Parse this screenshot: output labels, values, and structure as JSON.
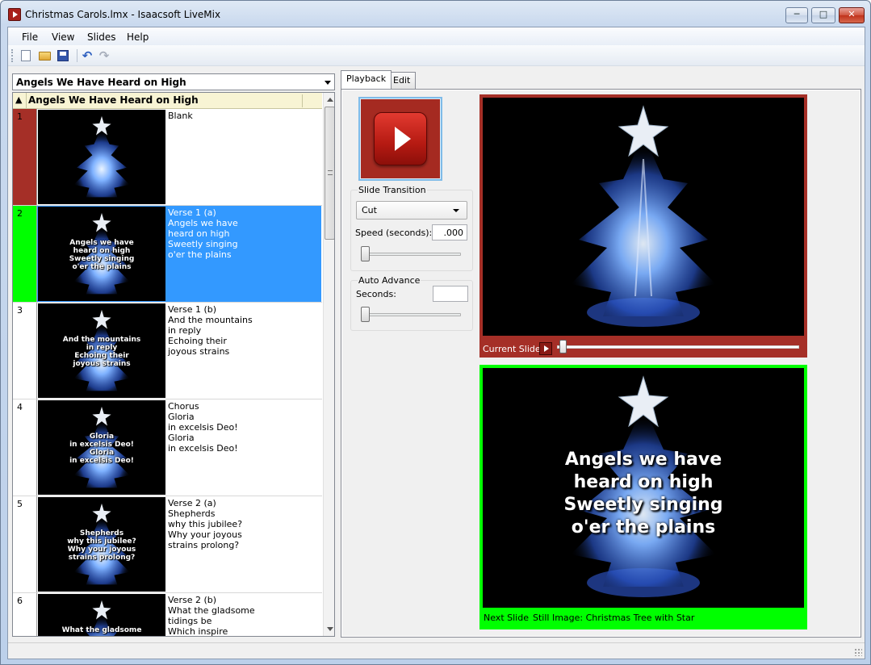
{
  "window": {
    "title": "Christmas Carols.lmx - Isaacsoft LiveMix",
    "min_label": "─",
    "max_label": "□",
    "close_label": "✕"
  },
  "menu": [
    "File",
    "View",
    "Slides",
    "Help"
  ],
  "toolbar": [
    "new-icon",
    "open-icon",
    "save-icon",
    "undo-icon",
    "redo-icon"
  ],
  "song_select": {
    "value": "Angels We Have Heard on High"
  },
  "grid": {
    "sort_glyph": "▲",
    "header": "Angels We Have Heard on High",
    "rows": [
      {
        "num": "1",
        "text": "Blank",
        "lyric": "",
        "color": "#a52f27"
      },
      {
        "num": "2",
        "text": "Verse 1 (a)\nAngels we have\nheard on high\nSweetly singing\no'er the plains",
        "lyric": "Angels we have\nheard on high\nSweetly singing\no'er the plains",
        "color": "#00ff00"
      },
      {
        "num": "3",
        "text": "Verse 1 (b)\nAnd the mountains\nin reply\nEchoing their\njoyous strains",
        "lyric": "And the mountains\nin reply\nEchoing their\njoyous strains",
        "color": "#ffffff"
      },
      {
        "num": "4",
        "text": "Chorus\nGloria\nin excelsis Deo!\nGloria\nin excelsis Deo!",
        "lyric": "Gloria\nin excelsis Deo!\nGloria\nin excelsis Deo!",
        "color": "#ffffff"
      },
      {
        "num": "5",
        "text": "Verse 2 (a)\nShepherds\nwhy this jubilee?\nWhy your joyous\nstrains prolong?",
        "lyric": "Shepherds\nwhy this jubilee?\nWhy your joyous\nstrains prolong?",
        "color": "#ffffff"
      },
      {
        "num": "6",
        "text": "Verse 2 (b)\nWhat the gladsome\ntidings be\nWhich inspire",
        "lyric": "What the gladsome",
        "color": "#ffffff"
      }
    ]
  },
  "tabs": [
    "Playback",
    "Edit"
  ],
  "playback": {
    "slide_transition_label": "Slide Transition",
    "transition_value": "Cut",
    "speed_label": "Speed (seconds):",
    "speed_value": ".000",
    "auto_advance_label": "Auto Advance",
    "seconds_label": "Seconds:",
    "seconds_value": ""
  },
  "current_slide": {
    "caption": "Current Slide",
    "color": "#a52f27"
  },
  "next_slide": {
    "caption": "Next Slide",
    "info": "Still Image: Christmas Tree with Star",
    "lyric": "Angels we have\nheard on high\nSweetly singing\no'er the plains",
    "color": "#00ff00"
  }
}
